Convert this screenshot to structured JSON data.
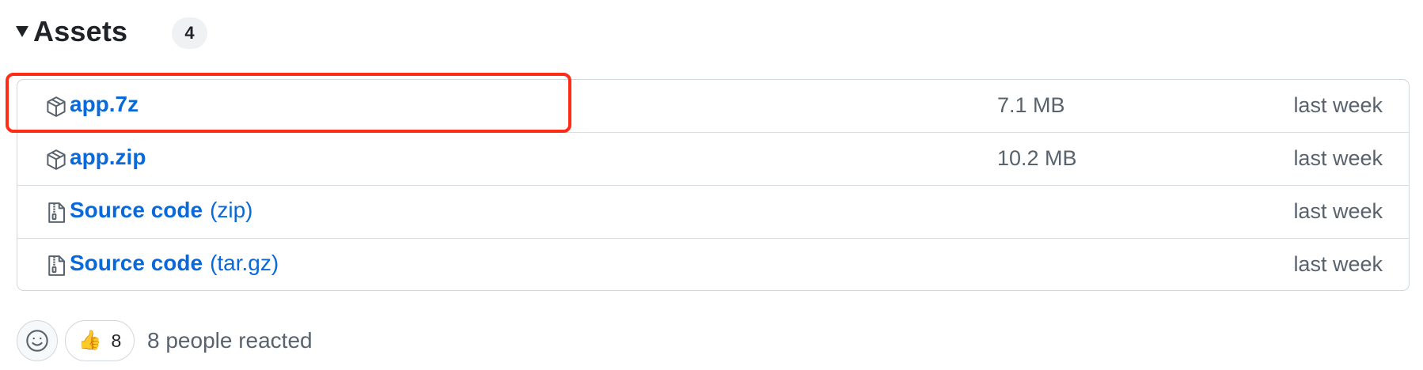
{
  "assets": {
    "title": "Assets",
    "count": "4",
    "items": [
      {
        "name": "app.7z",
        "suffix": "",
        "icon": "package-icon",
        "size": "7.1 MB",
        "date": "last week"
      },
      {
        "name": "app.zip",
        "suffix": "",
        "icon": "package-icon",
        "size": "10.2 MB",
        "date": "last week"
      },
      {
        "name": "Source code",
        "suffix": "(zip)",
        "icon": "file-zip-icon",
        "size": "",
        "date": "last week"
      },
      {
        "name": "Source code",
        "suffix": "(tar.gz)",
        "icon": "file-zip-icon",
        "size": "",
        "date": "last week"
      }
    ]
  },
  "reactions": {
    "emoji_picker_icon": "smiley-icon",
    "thumbs_up_emoji": "👍",
    "thumbs_up_count": "8",
    "summary": "8 people reacted"
  },
  "colors": {
    "link": "#0969da",
    "muted": "#59636e",
    "border": "#d0d7de",
    "highlight": "#ff2d16"
  }
}
